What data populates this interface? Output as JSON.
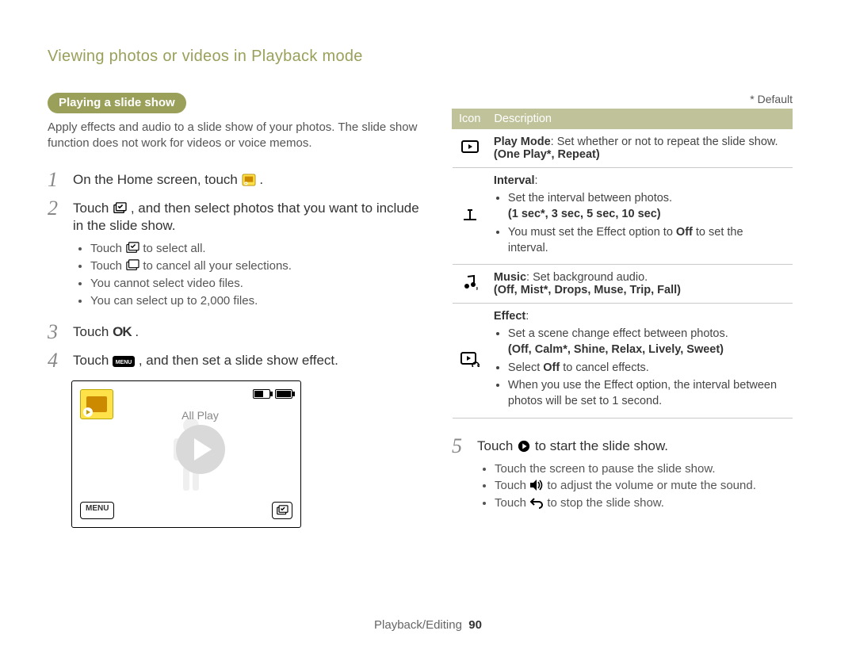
{
  "header": "Viewing photos or videos in Playback mode",
  "section_pill": "Playing a slide show",
  "intro": "Apply effects and audio to a slide show of your photos. The slide show function does not work for videos or voice memos.",
  "steps": {
    "s1_pre": "On the Home screen, touch ",
    "s1_post": ".",
    "s2_pre": "Touch ",
    "s2_post": ", and then select photos that you want to include in the slide show.",
    "s2_b1_pre": "Touch ",
    "s2_b1_post": " to select all.",
    "s2_b2_pre": "Touch ",
    "s2_b2_post": " to cancel all your selections.",
    "s2_b3": "You cannot select video files.",
    "s2_b4": "You can select up to 2,000 files.",
    "s3_pre": "Touch ",
    "s3_ok": "OK",
    "s3_post": ".",
    "s4_pre": "Touch ",
    "s4_menu": "MENU",
    "s4_post": ", and then set a slide show effect.",
    "s5_pre": "Touch ",
    "s5_post": " to start the slide show.",
    "s5_b1": "Touch the screen to pause the slide show.",
    "s5_b2_pre": "Touch ",
    "s5_b2_post": " to adjust the volume or mute the sound.",
    "s5_b3_pre": "Touch ",
    "s5_b3_post": " to stop the slide show."
  },
  "device": {
    "allplay": "All Play",
    "menu_label": "MENU"
  },
  "default_note": "* Default",
  "table": {
    "th_icon": "Icon",
    "th_desc": "Description",
    "r1_title": "Play Mode",
    "r1_body": ": Set whether or not to repeat the slide show.",
    "r1_opts": "(One Play*, Repeat)",
    "r2_title": "Interval",
    "r2_colon": ":",
    "r2_b1": "Set the interval between photos.",
    "r2_opts": "(1 sec*, 3 sec, 5 sec, 10 sec)",
    "r2_b2_pre": "You must set the Effect option to ",
    "r2_b2_bold": "Off",
    "r2_b2_post": " to set the interval.",
    "r3_title": "Music",
    "r3_body": ": Set background audio.",
    "r3_opts": "(Off, Mist*, Drops, Muse, Trip, Fall)",
    "r4_title": "Effect",
    "r4_colon": ":",
    "r4_b1": "Set a scene change effect between photos.",
    "r4_opts": "(Off, Calm*, Shine, Relax, Lively, Sweet)",
    "r4_b2_pre": "Select ",
    "r4_b2_bold": "Off",
    "r4_b2_post": " to cancel effects.",
    "r4_b3": "When you use the Effect option, the interval between photos will be set to 1 second."
  },
  "footer_section": "Playback/Editing",
  "footer_page": "90"
}
